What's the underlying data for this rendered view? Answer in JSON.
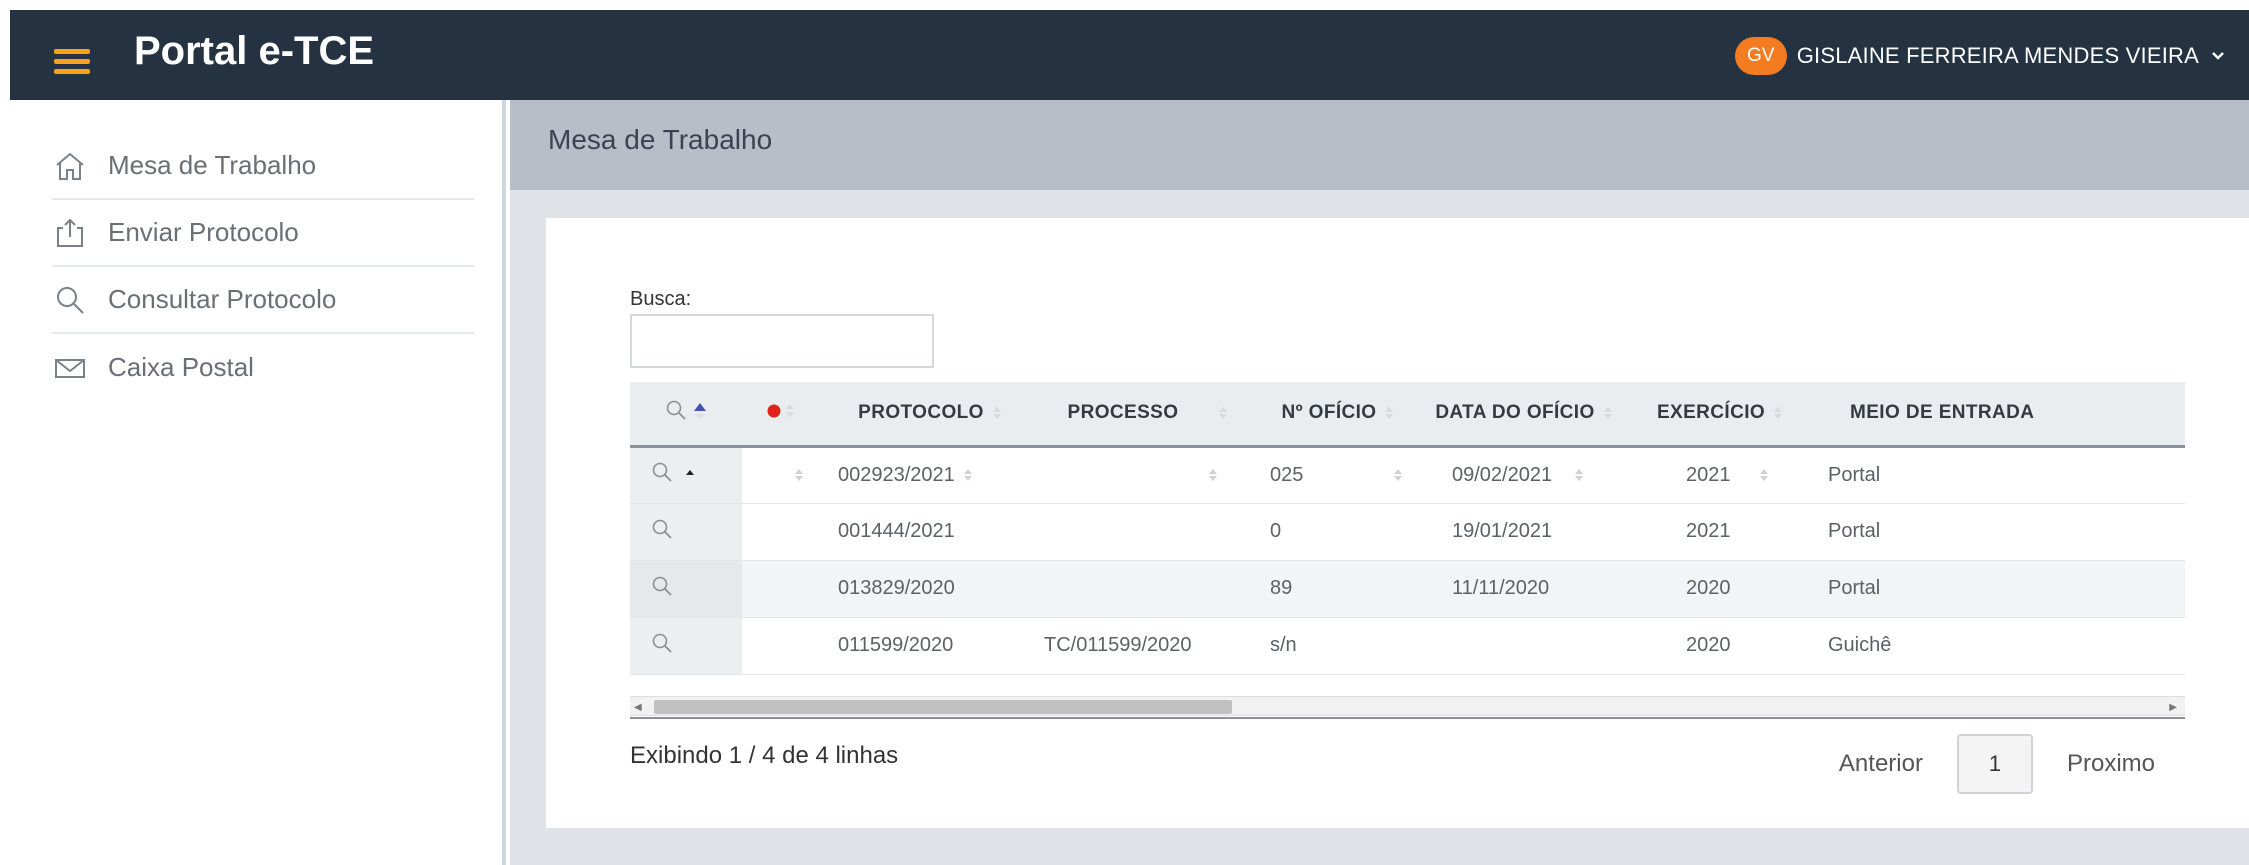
{
  "header": {
    "brand": "Portal e-TCE",
    "user_initials": "GV",
    "user_name": "GISLAINE FERREIRA MENDES VIEIRA"
  },
  "sidebar": {
    "items": [
      {
        "label": "Mesa de Trabalho",
        "icon": "home-icon"
      },
      {
        "label": "Enviar Protocolo",
        "icon": "upload-icon"
      },
      {
        "label": "Consultar Protocolo",
        "icon": "search-icon"
      },
      {
        "label": "Caixa Postal",
        "icon": "mail-icon"
      }
    ]
  },
  "main": {
    "page_title": "Mesa de Trabalho",
    "search_label": "Busca:",
    "search_value": ""
  },
  "table": {
    "columns": [
      "PROTOCOLO",
      "PROCESSO",
      "Nº OFÍCIO",
      "DATA DO OFÍCIO",
      "EXERCÍCIO",
      "MEIO DE ENTRADA"
    ],
    "rows": [
      {
        "protocolo": "002923/2021",
        "processo": "",
        "oficio": "025",
        "data": "09/02/2021",
        "exercicio": "2021",
        "meio": "Portal"
      },
      {
        "protocolo": "001444/2021",
        "processo": "",
        "oficio": "0",
        "data": "19/01/2021",
        "exercicio": "2021",
        "meio": "Portal"
      },
      {
        "protocolo": "013829/2020",
        "processo": "",
        "oficio": "89",
        "data": "11/11/2020",
        "exercicio": "2020",
        "meio": "Portal"
      },
      {
        "protocolo": "011599/2020",
        "processo": "TC/011599/2020",
        "oficio": "s/n",
        "data": "",
        "exercicio": "2020",
        "meio": "Guichê"
      }
    ]
  },
  "footer": {
    "info": "Exibindo 1 / 4 de 4 linhas",
    "prev": "Anterior",
    "page": "1",
    "next": "Proximo"
  },
  "colors": {
    "navbar": "#243241",
    "accent": "#f5a21c",
    "avatar": "#f47c20"
  }
}
